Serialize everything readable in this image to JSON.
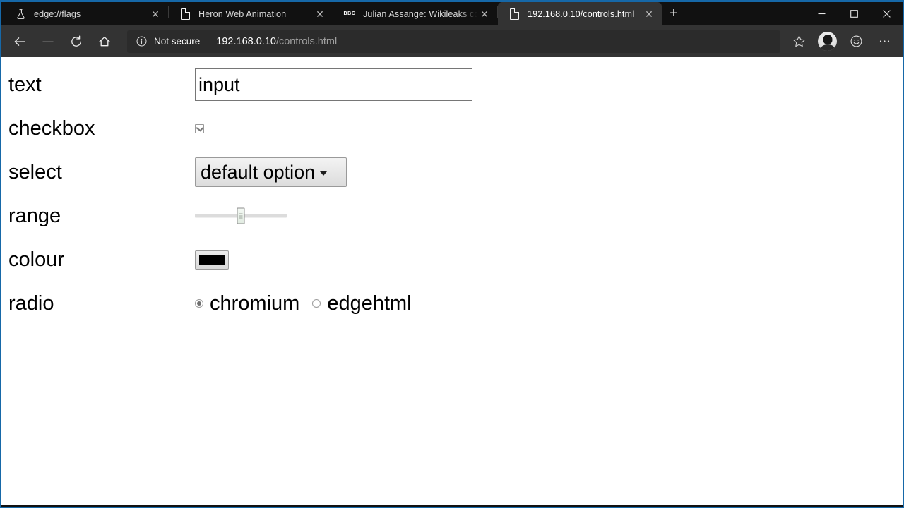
{
  "browser": {
    "accent_color": "#1668a8",
    "tabstrip_bg": "#111111",
    "toolbar_bg": "#333333",
    "active_tab_bg": "#333333",
    "tabs": [
      {
        "title": "edge://flags",
        "favicon": "flask-icon",
        "close_label": "✕",
        "active": false
      },
      {
        "title": "Heron Web Animation",
        "favicon": "file-icon",
        "close_label": "✕",
        "active": false
      },
      {
        "title": "Julian Assange: Wikileaks co-fou",
        "favicon": "bbc-icon",
        "favicon_text": "BBC",
        "close_label": "✕",
        "active": false
      },
      {
        "title": "192.168.0.10/controls.html",
        "favicon": "file-icon",
        "close_label": "✕",
        "active": true
      }
    ],
    "new_tab_label": "+",
    "window_controls": {
      "minimize": "—",
      "maximize": "□",
      "close": "✕"
    },
    "toolbar": {
      "back_label": "←",
      "forward_label": "→",
      "refresh_label": "↻",
      "home_label": "⌂",
      "favorite_label": "☆",
      "feedback_label": "☺",
      "settings_label": "…"
    },
    "omnibox": {
      "security_icon": "info-circle-icon",
      "security_text": "Not secure",
      "url_host": "192.168.0.10",
      "url_path": "/controls.html"
    }
  },
  "page": {
    "rows": [
      {
        "label": "text",
        "control": "text-input",
        "value": "input"
      },
      {
        "label": "checkbox",
        "control": "checkbox",
        "checked": true
      },
      {
        "label": "select",
        "control": "select",
        "selected": "default option",
        "caret": "▾"
      },
      {
        "label": "range",
        "control": "range",
        "value": 50,
        "min": 0,
        "max": 100
      },
      {
        "label": "colour",
        "control": "colour",
        "value": "#000000"
      },
      {
        "label": "radio",
        "control": "radio",
        "options": [
          {
            "label": "chromium",
            "checked": true
          },
          {
            "label": "edgehtml",
            "checked": false
          }
        ]
      }
    ]
  }
}
